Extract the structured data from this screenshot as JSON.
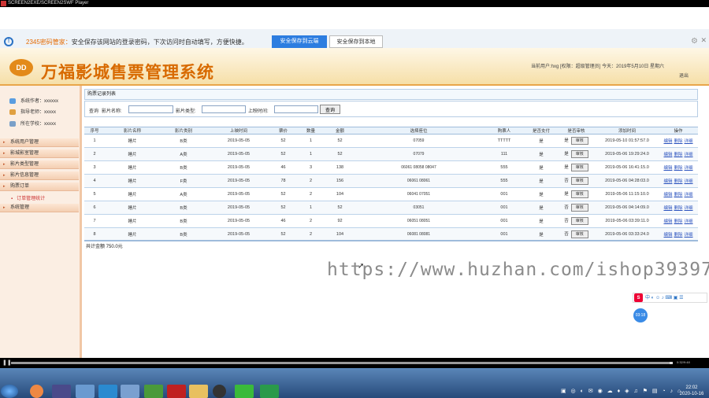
{
  "window": {
    "title": "SCREEN2EXE/SCREEN2SWF Player"
  },
  "infobar": {
    "brand": "2345",
    "brand_suffix": "密码管家：",
    "message": "安全保存该网站的登录密码，下次访问时自动填写，方便快捷。",
    "save_cloud": "安全保存到云端",
    "save_local": "安全保存到本地"
  },
  "app": {
    "logo_text": "DD",
    "title": "万福影城售票管理系统",
    "user_info": "当前用户:hxg [权限：超级管理员] 今天：2019年5月10日 星期六",
    "logout": "退出"
  },
  "sidebar": {
    "info": [
      {
        "label": "系统作者：xxxxxx"
      },
      {
        "label": "指导老师：xxxxx"
      },
      {
        "label": "所在学校：xxxxx"
      }
    ],
    "menus": [
      {
        "label": "系统用户管理"
      },
      {
        "label": "影城影室管理"
      },
      {
        "label": "影片类型管理"
      },
      {
        "label": "影片信息管理"
      },
      {
        "label": "购票订单"
      }
    ],
    "submenu": "订单管理统计",
    "last_menu": "系统管理"
  },
  "main": {
    "crumb": "购票记录列表",
    "search": {
      "label_query": "查询",
      "label_name": "影片名称:",
      "label_type": "影片类型:",
      "label_time": "上映时间:",
      "name_value": "",
      "type_value": "",
      "time_value": "",
      "button": "查询"
    },
    "columns": [
      "序号",
      "影片名称",
      "影片类别",
      "上映时间",
      "票价",
      "数量",
      "金额",
      "选择座位",
      "购票人",
      "是否支付",
      "是否审核",
      "添加时间",
      "操作"
    ],
    "rows": [
      {
        "no": "1",
        "name": "睡片",
        "type": "B类",
        "date": "2019-05-05",
        "price": "52",
        "qty": "1",
        "amount": "52",
        "seat": "07059",
        "buyer": "TTTTT",
        "paid": "是",
        "reviewed": "是",
        "added": "2019-05-10 01:57:57.0"
      },
      {
        "no": "2",
        "name": "睡片",
        "type": "A类",
        "date": "2019-05-05",
        "price": "52",
        "qty": "1",
        "amount": "52",
        "seat": "07079",
        "buyer": "111",
        "paid": "是",
        "reviewed": "是",
        "added": "2019-05-06 19:29:24.0"
      },
      {
        "no": "3",
        "name": "睡片",
        "type": "B类",
        "date": "2019-05-05",
        "price": "46",
        "qty": "3",
        "amount": "138",
        "seat": "06061 08058 08047",
        "buyer": "555",
        "paid": "是",
        "reviewed": "是",
        "added": "2019-05-06 16:41:15.0"
      },
      {
        "no": "4",
        "name": "睡片",
        "type": "F类",
        "date": "2019-05-05",
        "price": "78",
        "qty": "2",
        "amount": "156",
        "seat": "06061 08061",
        "buyer": "555",
        "paid": "是",
        "reviewed": "否",
        "added": "2019-05-06 04:28:03.0"
      },
      {
        "no": "5",
        "name": "睡片",
        "type": "A类",
        "date": "2019-05-05",
        "price": "52",
        "qty": "2",
        "amount": "104",
        "seat": "06041 07051",
        "buyer": "001",
        "paid": "是",
        "reviewed": "是",
        "added": "2019-05-06 11:15:10.0"
      },
      {
        "no": "6",
        "name": "睡片",
        "type": "B类",
        "date": "2019-05-05",
        "price": "52",
        "qty": "1",
        "amount": "52",
        "seat": "03051",
        "buyer": "001",
        "paid": "是",
        "reviewed": "否",
        "added": "2019-05-06 04:14:09.0"
      },
      {
        "no": "7",
        "name": "睡片",
        "type": "B类",
        "date": "2019-05-05",
        "price": "46",
        "qty": "2",
        "amount": "92",
        "seat": "06051 08051",
        "buyer": "001",
        "paid": "是",
        "reviewed": "否",
        "added": "2019-05-06 03:39:11.0"
      },
      {
        "no": "8",
        "name": "睡片",
        "type": "B类",
        "date": "2019-05-05",
        "price": "52",
        "qty": "2",
        "amount": "104",
        "seat": "06081 08081",
        "buyer": "001",
        "paid": "是",
        "reviewed": "否",
        "added": "2019-05-06 03:33:24.0"
      }
    ],
    "review_btn": "审核",
    "op_edit": "编辑",
    "op_delete": "删除",
    "op_detail": "详细",
    "total": "共计金额 750.0元"
  },
  "watermark": "https://www.huzhan.com/ishop39397",
  "ime": {
    "label": "中"
  },
  "fab": "03:18",
  "player": {
    "time": "0:32/9:48"
  },
  "taskbar": {
    "time": "22:02",
    "date": "2020-10-16"
  }
}
